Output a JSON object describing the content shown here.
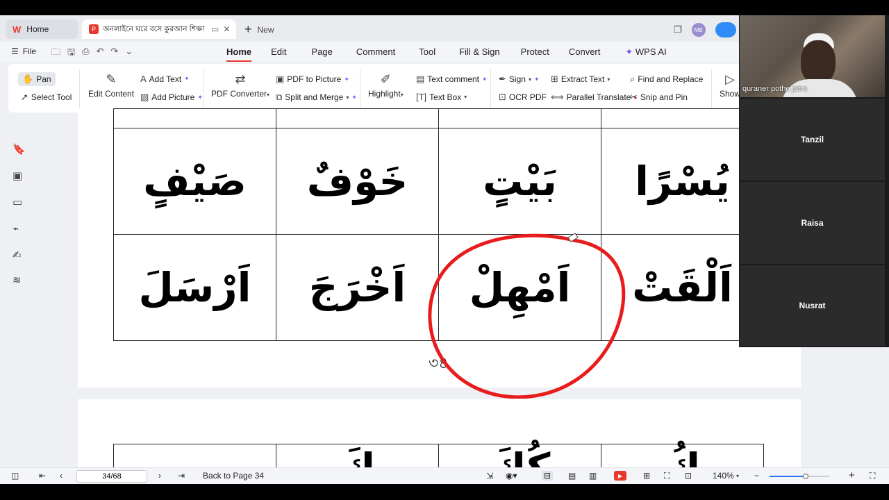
{
  "tabs": {
    "home_label": "Home",
    "doc_title": "অনলাইনে ঘরে বসে কুরআন শিক্ষা",
    "new_label": "New",
    "avatar_initials": "MB"
  },
  "menu": {
    "file_label": "File",
    "tabs": [
      "Home",
      "Edit",
      "Page",
      "Comment",
      "Tool",
      "Fill & Sign",
      "Protect",
      "Convert"
    ],
    "active_tab": "Home",
    "ai_label": "WPS AI"
  },
  "ribbon": {
    "pan": "Pan",
    "select_tool": "Select Tool",
    "edit_content": "Edit Content",
    "add_text": "Add Text",
    "add_picture": "Add Picture",
    "pdf_converter": "PDF Converter",
    "pdf_to_picture": "PDF to Picture",
    "split_merge": "Split and Merge",
    "highlight": "Highlight",
    "text_comment": "Text comment",
    "text_box": "Text Box",
    "sign": "Sign",
    "ocr_pdf": "OCR PDF",
    "extract_text": "Extract Text",
    "parallel_translate": "Parallel Translate",
    "find_replace": "Find and Replace",
    "snip_pin": "Snip and Pin",
    "show": "Show"
  },
  "document": {
    "page1_rows": [
      [
        "صَيْفٍ",
        "خَوْفٌ",
        "بَيْتٍ",
        "يُسْرًا"
      ],
      [
        "اَرْسَلَ",
        "اَخْرَجَ",
        "اَمْهِلْ",
        "اَلْقَتْ"
      ]
    ],
    "page_number": "৩৪",
    "page2_row": [
      "",
      "كَ",
      "كُكَ",
      "كُ"
    ]
  },
  "status": {
    "page_indicator": "34/68",
    "back_to_page": "Back to Page 34",
    "zoom": "140%",
    "zoom_level": 0.6
  },
  "meeting": {
    "presenter_name": "quraner pothe jatra",
    "participants": [
      "Tanzil",
      "Raisa",
      "Nusrat"
    ]
  },
  "colors": {
    "accent": "#e8392f",
    "annotation": "#e81c1c",
    "ai": "#7a4ef0"
  }
}
